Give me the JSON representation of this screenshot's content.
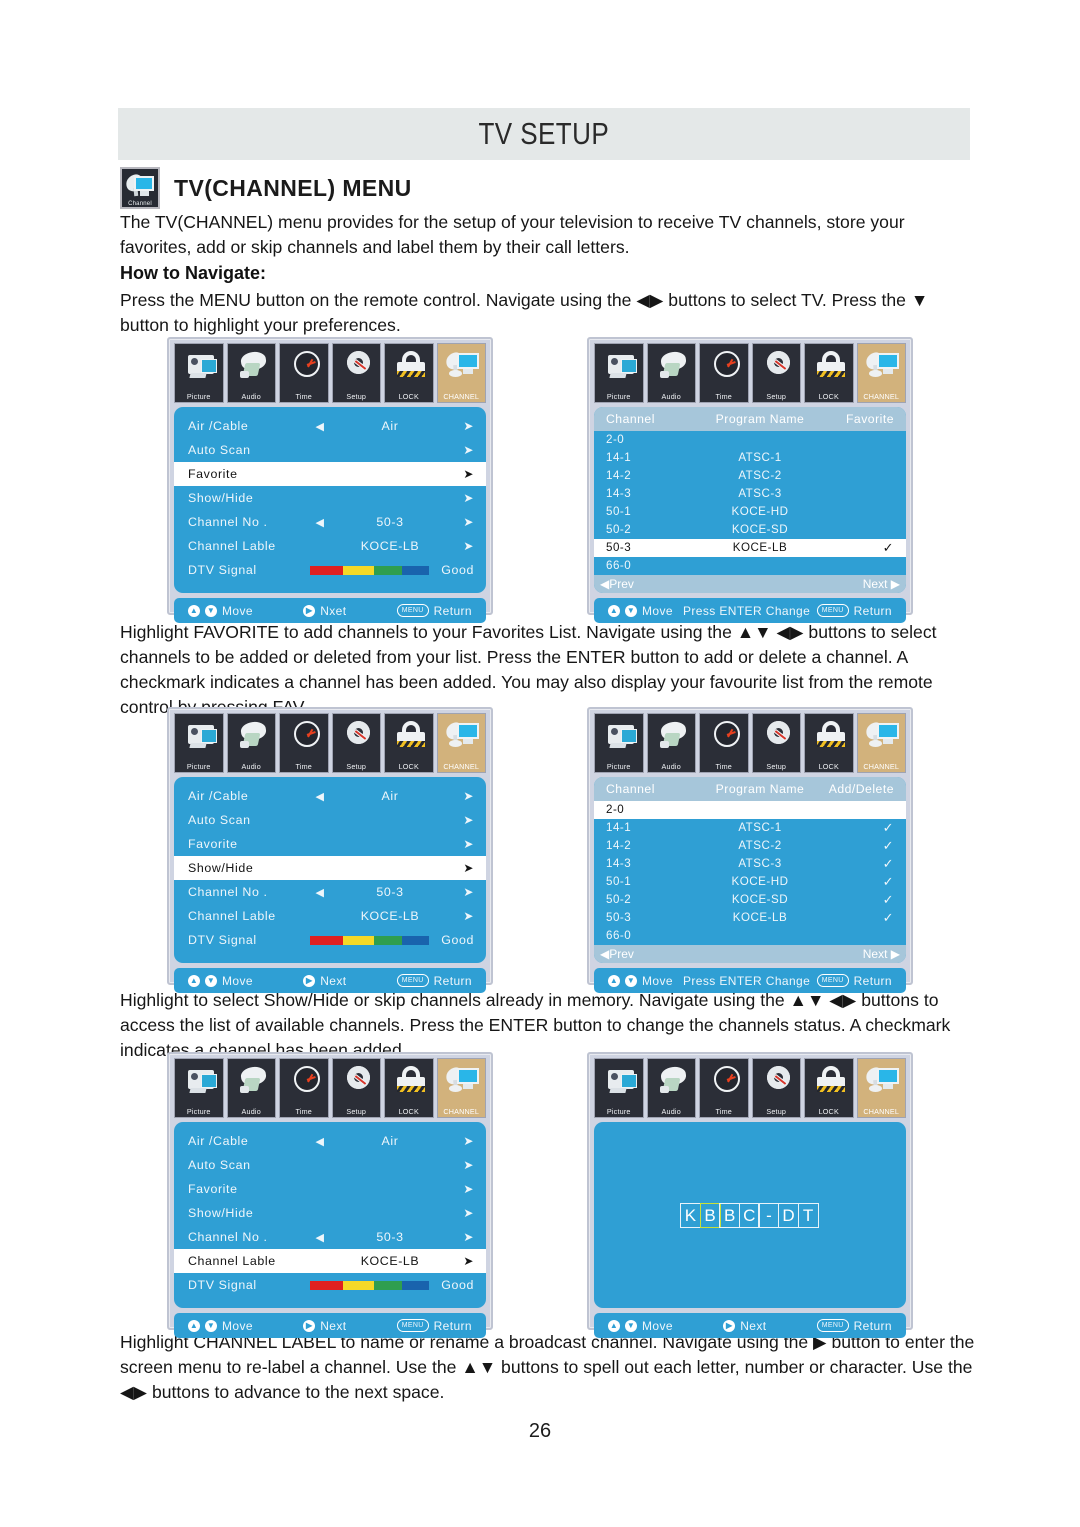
{
  "header": {
    "title": "TV SETUP"
  },
  "section": {
    "icon_label": "Channel",
    "title": "TV(CHANNEL) MENU"
  },
  "paragraphs": {
    "intro": "The TV(CHANNEL) menu provides for the setup of your television to receive TV channels, store your favorites, add or skip channels and label them by their call letters.",
    "how_to_navigate_head": "How to Navigate:",
    "how_to_navigate": "Press the MENU button on the remote control. Navigate using the ◀▶ buttons to select TV. Press the ▼ button to highlight your preferences.",
    "favorite": "Highlight FAVORITE to add channels to your Favorites List. Navigate using the ▲▼ ◀▶ buttons to select channels to be added or deleted from your list. Press the ENTER button to add or delete a channel. A checkmark indicates a channel has been added. You may also display your favourite list from the remote control by pressing FAV.",
    "showhide": "Highlight to select Show/Hide or skip channels already in memory. Navigate using the ▲▼ ◀▶ buttons to access the list of available channels. Press the ENTER button to change the channels status. A checkmark indicates a channel has been added.",
    "channel_label": "Highlight CHANNEL LABEL to name or rename a broadcast channel. Navigate using the ▶ button to enter the screen menu to re-label a channel. Use the ▲▼ buttons to spell out each letter, number or character. Use the ◀▶ buttons to advance to the next space."
  },
  "page_number": "26",
  "colors": {
    "osd_blue": "#2f9fd4",
    "osd_header_blue": "#a6c6da",
    "active_tab": "#d2b27c",
    "tab_dark": "#2b2e37",
    "band_gray": "#e4e8e8",
    "signal_red": "#e02020",
    "signal_yellow": "#f5d928",
    "signal_green": "#2f9e4f",
    "signal_blue": "#1963ad",
    "cursor_green": "#c9e03a"
  },
  "tabs": [
    {
      "label": "Picture",
      "icon": "camcorder-icon",
      "active": false
    },
    {
      "label": "Audio",
      "icon": "speaker-icon",
      "active": false
    },
    {
      "label": "Time",
      "icon": "clock-icon",
      "active": false
    },
    {
      "label": "Setup",
      "icon": "gear-icon",
      "active": false
    },
    {
      "label": "LOCK",
      "icon": "padlock-icon",
      "active": false
    },
    {
      "label": "CHANNEL",
      "icon": "channel-dish-monitor-icon",
      "active": true
    }
  ],
  "menu_rows": {
    "air_cable": {
      "label": "Air /Cable",
      "value": "Air",
      "left_arrow": "◀",
      "right_arrow": "➤"
    },
    "auto_scan": {
      "label": "Auto Scan",
      "value": "",
      "right_arrow": "➤"
    },
    "favorite": {
      "label": "Favorite",
      "value": "",
      "right_arrow": "➤"
    },
    "show_hide": {
      "label": "Show/Hide",
      "value": "",
      "right_arrow": "➤"
    },
    "channel_no": {
      "label": "Channel No .",
      "value": "50-3",
      "left_arrow": "◀",
      "right_arrow": "➤"
    },
    "channel_lable": {
      "label": "Channel Lable",
      "value": "KOCE-LB",
      "right_arrow": "➤"
    },
    "dtv_signal": {
      "label": "DTV Signal",
      "value": "Good"
    }
  },
  "selected_rows": {
    "screen1": "favorite",
    "screen3": "show_hide",
    "screen5": "channel_lable"
  },
  "hints": {
    "move": "Move",
    "next": "Next",
    "next_typo": "Nxet",
    "return": "Return",
    "menu_key": "MENU",
    "press_enter_change": "Press ENTER Change",
    "prev": "Prev",
    "next_page": "Next"
  },
  "channel_list": {
    "headers_favorite": {
      "c1": "Channel",
      "c2": "Program Name",
      "c3": "Favorite"
    },
    "headers_adddelete": {
      "c1": "Channel",
      "c2": "Program Name",
      "c3": "Add/Delete"
    },
    "favorite_rows": [
      {
        "channel": "2-0",
        "program": "",
        "mark": "",
        "selected": false
      },
      {
        "channel": "14-1",
        "program": "ATSC-1",
        "mark": "",
        "selected": false
      },
      {
        "channel": "14-2",
        "program": "ATSC-2",
        "mark": "",
        "selected": false
      },
      {
        "channel": "14-3",
        "program": "ATSC-3",
        "mark": "",
        "selected": false
      },
      {
        "channel": "50-1",
        "program": "KOCE-HD",
        "mark": "",
        "selected": false
      },
      {
        "channel": "50-2",
        "program": "KOCE-SD",
        "mark": "",
        "selected": false
      },
      {
        "channel": "50-3",
        "program": "KOCE-LB",
        "mark": "✓",
        "selected": true
      },
      {
        "channel": "66-0",
        "program": "",
        "mark": "",
        "selected": false
      }
    ],
    "adddelete_rows": [
      {
        "channel": "2-0",
        "program": "",
        "mark": "",
        "selected": true
      },
      {
        "channel": "14-1",
        "program": "ATSC-1",
        "mark": "✓",
        "selected": false
      },
      {
        "channel": "14-2",
        "program": "ATSC-2",
        "mark": "✓",
        "selected": false
      },
      {
        "channel": "14-3",
        "program": "ATSC-3",
        "mark": "✓",
        "selected": false
      },
      {
        "channel": "50-1",
        "program": "KOCE-HD",
        "mark": "✓",
        "selected": false
      },
      {
        "channel": "50-2",
        "program": "KOCE-SD",
        "mark": "✓",
        "selected": false
      },
      {
        "channel": "50-3",
        "program": "KOCE-LB",
        "mark": "✓",
        "selected": false
      },
      {
        "channel": "66-0",
        "program": "",
        "mark": "",
        "selected": false
      }
    ]
  },
  "label_editor": {
    "cells": [
      "K",
      "B",
      "B",
      "C",
      "-",
      "D",
      "T"
    ],
    "cursor_index": 1
  }
}
